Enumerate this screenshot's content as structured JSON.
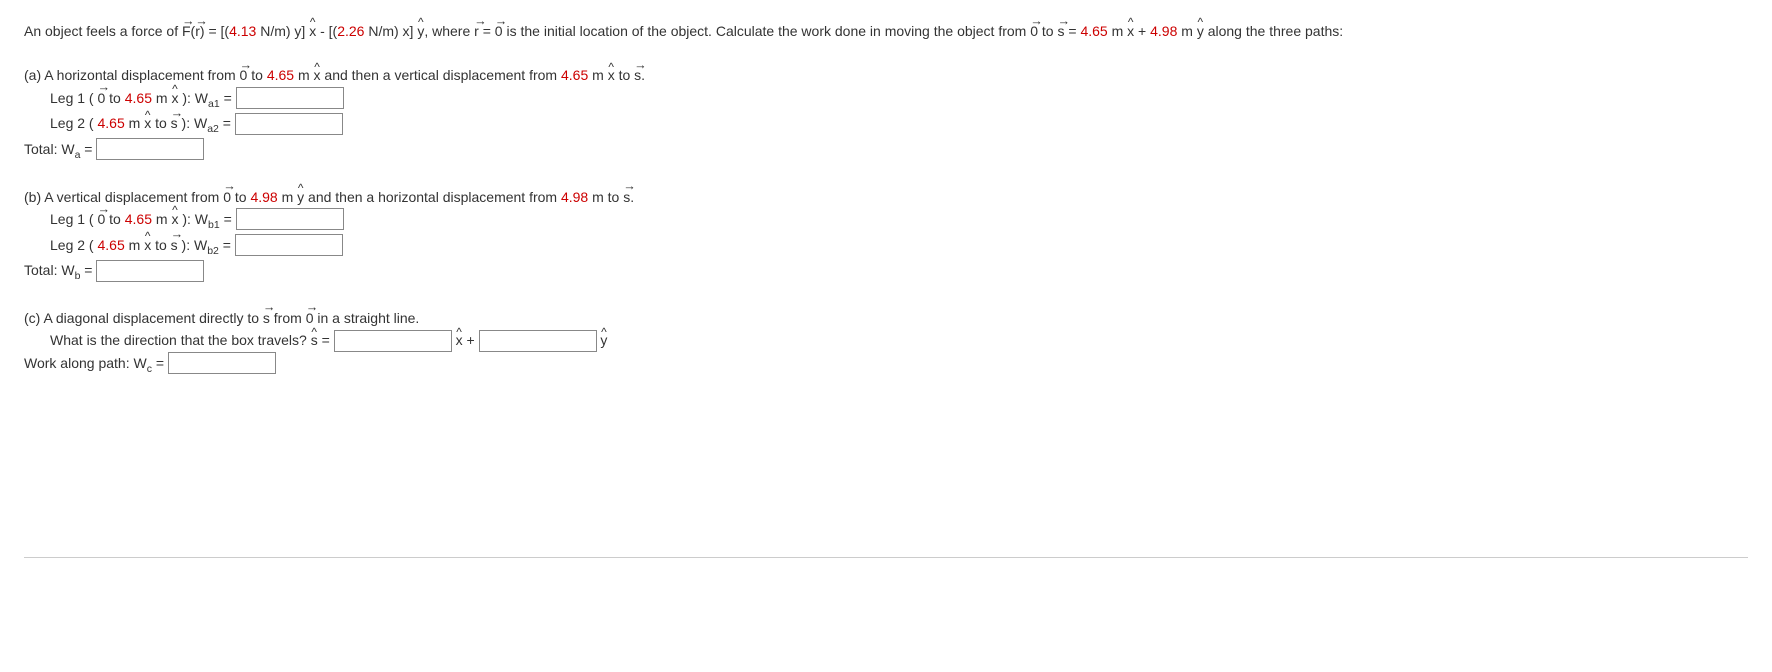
{
  "intro": {
    "p1": "An object feels a force of ",
    "F": "F",
    "paren_r": "r",
    "eq1": ") = [(",
    "k1": "4.13",
    "eq2": " N/m) y] ",
    "xhat1": "x",
    "eq3": " - [(",
    "k2": "2.26",
    "eq4": " N/m) x] ",
    "yhat1": "y",
    "eq5": ", where ",
    "rvec": "r",
    "eq6": " = ",
    "zero1": "0",
    "eq7": " is the initial location of the object. Calculate the work done in moving the object from ",
    "zero2": "0",
    "eq8": " to ",
    "svec": "s",
    "eq9": " = ",
    "sx": "4.65",
    "eq10": " m ",
    "xhat2": "x",
    "eq11": " + ",
    "sy": "4.98",
    "eq12": " m ",
    "yhat2": "y",
    "eq13": " along the three paths:"
  },
  "a": {
    "desc1": "(a) A horizontal displacement from ",
    "zero": "0",
    "desc2": " to ",
    "val1": "4.65",
    "desc3": " m ",
    "xhat": "x",
    "desc4": " and then a vertical displacement from ",
    "val2": "4.65",
    "desc5": " m ",
    "xhat2": "x",
    "desc6": " to ",
    "svec": "s",
    "desc7": ".",
    "leg1_a": "Leg 1 ( ",
    "leg1_zero": "0",
    "leg1_b": " to ",
    "leg1_val": "4.65",
    "leg1_c": " m ",
    "leg1_xhat": "x",
    "leg1_d": " ): W",
    "leg1_sub": "a1",
    "leg1_eq": " = ",
    "leg2_a": "Leg 2 ( ",
    "leg2_val": "4.65",
    "leg2_b": " m ",
    "leg2_xhat": "x",
    "leg2_c": " to ",
    "leg2_svec": "s",
    "leg2_d": " ): W",
    "leg2_sub": "a2",
    "leg2_eq": " = ",
    "total_a": "Total: W",
    "total_sub": "a",
    "total_eq": " = "
  },
  "b": {
    "desc1": "(b) A vertical displacement from ",
    "zero": "0",
    "desc2": " to ",
    "val1": "4.98",
    "desc3": " m ",
    "yhat": "y",
    "desc4": " and then a horizontal displacement from ",
    "val2": "4.98",
    "desc5": " m to ",
    "svec": "s",
    "desc6": ".",
    "leg1_a": "Leg 1 ( ",
    "leg1_zero": "0",
    "leg1_b": " to ",
    "leg1_val": "4.65",
    "leg1_c": " m ",
    "leg1_xhat": "x",
    "leg1_d": " ): W",
    "leg1_sub": "b1",
    "leg1_eq": " = ",
    "leg2_a": "Leg 2 ( ",
    "leg2_val": "4.65",
    "leg2_b": " m ",
    "leg2_xhat": "x",
    "leg2_c": " to ",
    "leg2_svec": "s",
    "leg2_d": " ): W",
    "leg2_sub": "b2",
    "leg2_eq": " = ",
    "total_a": "Total: W",
    "total_sub": "b",
    "total_eq": " = "
  },
  "c": {
    "desc1": "(c) A diagonal displacement directly to ",
    "svec": "s",
    "desc2": " from ",
    "zero": "0",
    "desc3": " in a straight line.",
    "dir1": "What is the direction that the box travels? ",
    "shat": "s",
    "dir2": " = ",
    "xhat": "x",
    "plus": " + ",
    "yhat": "y",
    "work1": "Work along path: W",
    "work_sub": "c",
    "work_eq": " = "
  }
}
